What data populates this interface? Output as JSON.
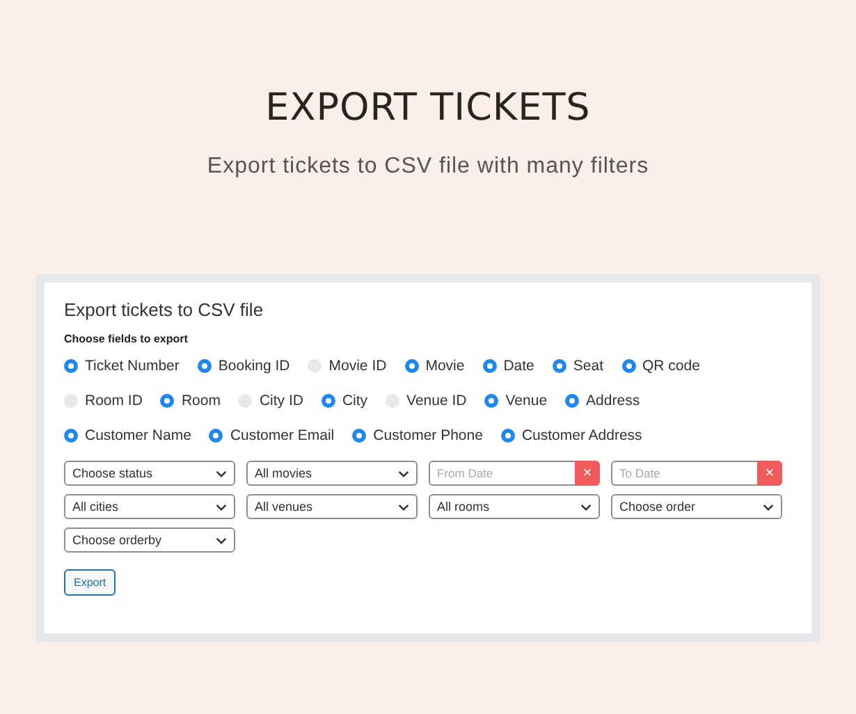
{
  "header": {
    "title": "EXPORT TICKETS",
    "subtitle": "Export tickets to CSV file with many filters"
  },
  "panel": {
    "title": "Export tickets to CSV file",
    "fields_label": "Choose fields to export",
    "field_rows": [
      [
        {
          "label": "Ticket Number",
          "selected": true
        },
        {
          "label": "Booking ID",
          "selected": true
        },
        {
          "label": "Movie ID",
          "selected": false
        },
        {
          "label": "Movie",
          "selected": true
        },
        {
          "label": "Date",
          "selected": true
        },
        {
          "label": "Seat",
          "selected": true
        },
        {
          "label": "QR code",
          "selected": true
        }
      ],
      [
        {
          "label": "Room ID",
          "selected": false
        },
        {
          "label": "Room",
          "selected": true
        },
        {
          "label": "City ID",
          "selected": false
        },
        {
          "label": "City",
          "selected": true
        },
        {
          "label": "Venue ID",
          "selected": false
        },
        {
          "label": "Venue",
          "selected": true
        },
        {
          "label": "Address",
          "selected": true
        }
      ],
      [
        {
          "label": "Customer Name",
          "selected": true
        },
        {
          "label": "Customer Email",
          "selected": true
        },
        {
          "label": "Customer Phone",
          "selected": true
        },
        {
          "label": "Customer Address",
          "selected": true
        }
      ]
    ],
    "filter_rows": [
      [
        {
          "kind": "select",
          "value": "Choose status"
        },
        {
          "kind": "select",
          "value": "All movies"
        },
        {
          "kind": "date",
          "placeholder": "From Date",
          "clear": "×"
        },
        {
          "kind": "date",
          "placeholder": "To Date",
          "clear": "×"
        }
      ],
      [
        {
          "kind": "select",
          "value": "All cities"
        },
        {
          "kind": "select",
          "value": "All venues"
        },
        {
          "kind": "select",
          "value": "All rooms"
        },
        {
          "kind": "select",
          "value": "Choose order"
        }
      ],
      [
        {
          "kind": "select",
          "value": "Choose orderby"
        }
      ]
    ],
    "button": "Export"
  }
}
